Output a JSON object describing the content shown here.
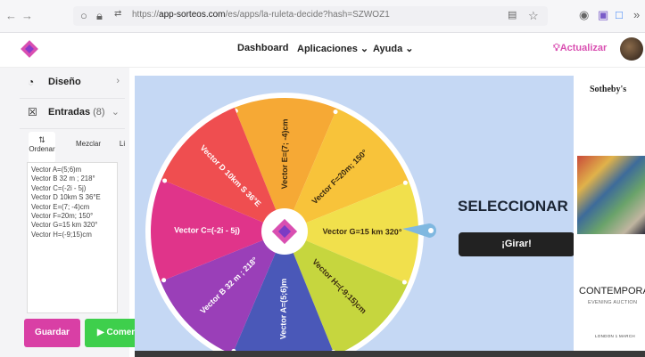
{
  "browser": {
    "back_glyph": "←",
    "forward_glyph": "→",
    "url_prefix": "https://",
    "url_main": "app-sorteos.com",
    "url_rest": "/es/apps/la-ruleta-decide?hash=SZWOZ1"
  },
  "app": {
    "nav": [
      {
        "label": "Dashboard"
      },
      {
        "label": "Aplicaciones ⌄"
      },
      {
        "label": "Ayuda ⌄"
      }
    ],
    "actualizar_label": "Actualizar",
    "brand_color": "#d94fb1"
  },
  "sidebar": {
    "diseno_label": "Diseño",
    "entradas_label": "Entradas",
    "entradas_count": "(8)",
    "tabs": [
      {
        "label": "Ordenar"
      },
      {
        "label": "Mezclar"
      },
      {
        "label": "Li"
      }
    ],
    "entries_text": "Vector A=(5;6)m\nVector B 32 m ; 218°\nVector C=(-2i - 5j)\nVector D 10km S 36°E\nVector E=(7; -4)cm\nVector F=20m; 150°\nVector G=15 km 320°\nVector H=(-9;15)cm",
    "guardar_label": "Guardar",
    "comenzar_label": "Comen"
  },
  "wheel": {
    "segments": [
      {
        "label": "Vector E=(7; -4)cm",
        "color": "#f6a935"
      },
      {
        "label": "Vector F=20m; 150°",
        "color": "#f8c33a"
      },
      {
        "label": "Vector G=15 km 320°",
        "color": "#f1e04c"
      },
      {
        "label": "Vector H=(-9;15)cm",
        "color": "#c6d63e"
      },
      {
        "label": "Vector A=(5;6)m",
        "color": "#4a58b8"
      },
      {
        "label": "Vector B 32 m ; 218°",
        "color": "#9a3fb8"
      },
      {
        "label": "Vector C=(-2i - 5j)",
        "color": "#e0348a"
      },
      {
        "label": "Vector D 10km S 36°E",
        "color": "#ef4e50"
      }
    ]
  },
  "main": {
    "select_title": "SELECCIONAR",
    "girar_label": "¡Girar!"
  },
  "ad": {
    "brand": "Sotheby's",
    "title": "CONTEMPORAR",
    "subtitle": "EVENING AUCTION",
    "footer": "LONDON 1 MARCH"
  }
}
